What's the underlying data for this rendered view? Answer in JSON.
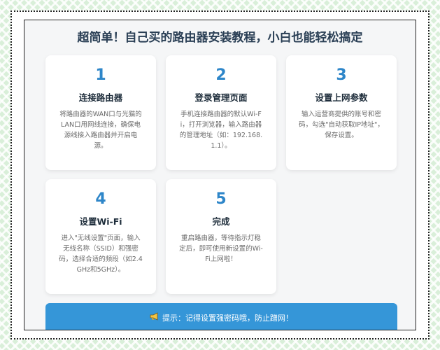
{
  "title": "超简单！自己买的路由器安装教程，小白也能轻松搞定",
  "steps": [
    {
      "number": "1",
      "title": "连接路由器",
      "description": "将路由器的WAN口与光猫的LAN口用网线连接，确保电源线接入路由器并开启电源。"
    },
    {
      "number": "2",
      "title": "登录管理页面",
      "description": "手机连接路由器的默认Wi-Fi，打开浏览器，输入路由器的管理地址（如：192.168.1.1）。"
    },
    {
      "number": "3",
      "title": "设置上网参数",
      "description": "输入运营商提供的账号和密码，勾选\"自动获取IP地址\"，保存设置。"
    },
    {
      "number": "4",
      "title": "设置Wi-Fi",
      "description": "进入\"无线设置\"页面，输入无线名称（SSID）和强密码，选择合适的频段（如2.4GHz和5GHz）。"
    },
    {
      "number": "5",
      "title": "完成",
      "description": "重启路由器，等待指示灯稳定后，即可使用新设置的Wi-Fi上网啦！"
    }
  ],
  "tip": {
    "icon": "megaphone-icon",
    "text": "提示：记得设置强密码哦，防止蹭网！"
  },
  "colors": {
    "accent": "#2e86c9",
    "tip_background": "#3596d8",
    "title": "#2a3f55"
  }
}
